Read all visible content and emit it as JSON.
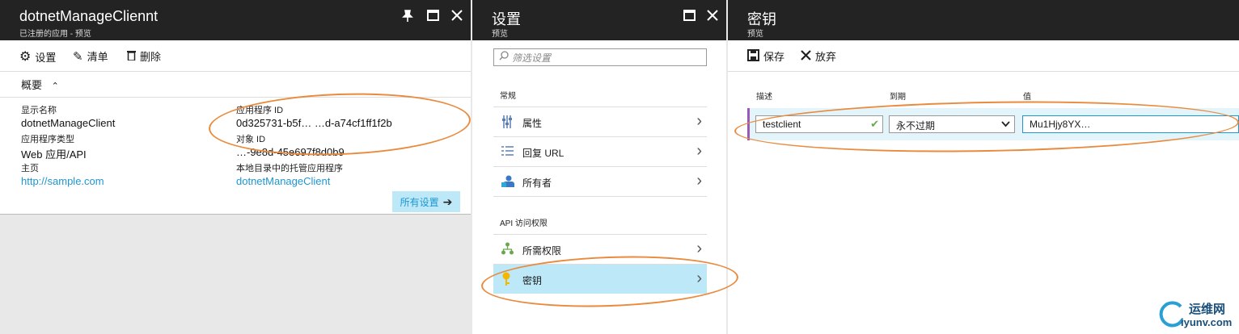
{
  "blade1": {
    "title": "dotnetManageCliennt",
    "subtitle": "已注册的应用 - 预览",
    "commands": {
      "settings": "设置",
      "manifest": "清单",
      "delete": "删除"
    },
    "essentials_label": "概要",
    "fields": {
      "display_name_label": "显示名称",
      "display_name_value": "dotnetManageClient",
      "app_type_label": "应用程序类型",
      "app_type_value": "Web 应用/API",
      "home_label": "主页",
      "home_value": "http://sample.com",
      "app_id_label": "应用程序 ID",
      "app_id_value": "0d325731-b5f… …d-a74cf1ff1f2b",
      "object_id_label": "对象 ID",
      "object_id_value": "…-9e8d-45e697f8d0b9",
      "managed_app_label": "本地目录中的托管应用程序",
      "managed_app_value": "dotnetManageClient"
    },
    "all_settings_button": "所有设置"
  },
  "blade2": {
    "title": "设置",
    "subtitle": "预览",
    "search_placeholder": "筛选设置",
    "section_general": "常规",
    "section_api": "API 访问权限",
    "items": {
      "properties": "属性",
      "reply_url": "回复 URL",
      "owners": "所有者",
      "required_permissions": "所需权限",
      "keys": "密钥"
    }
  },
  "blade3": {
    "title": "密钥",
    "subtitle": "预览",
    "commands": {
      "save": "保存",
      "discard": "放弃"
    },
    "columns": {
      "description": "描述",
      "expires": "到期",
      "value": "值"
    },
    "row": {
      "description": "testclient",
      "expires": "永不过期",
      "value": "Mu1Hjy8YX…"
    }
  },
  "watermark": {
    "name": "运维网",
    "url": "iyunv.com"
  },
  "colors": {
    "accent": "#1e96d1",
    "selected": "#bde8f7",
    "annotation": "#e98a3c",
    "header": "#232323"
  }
}
